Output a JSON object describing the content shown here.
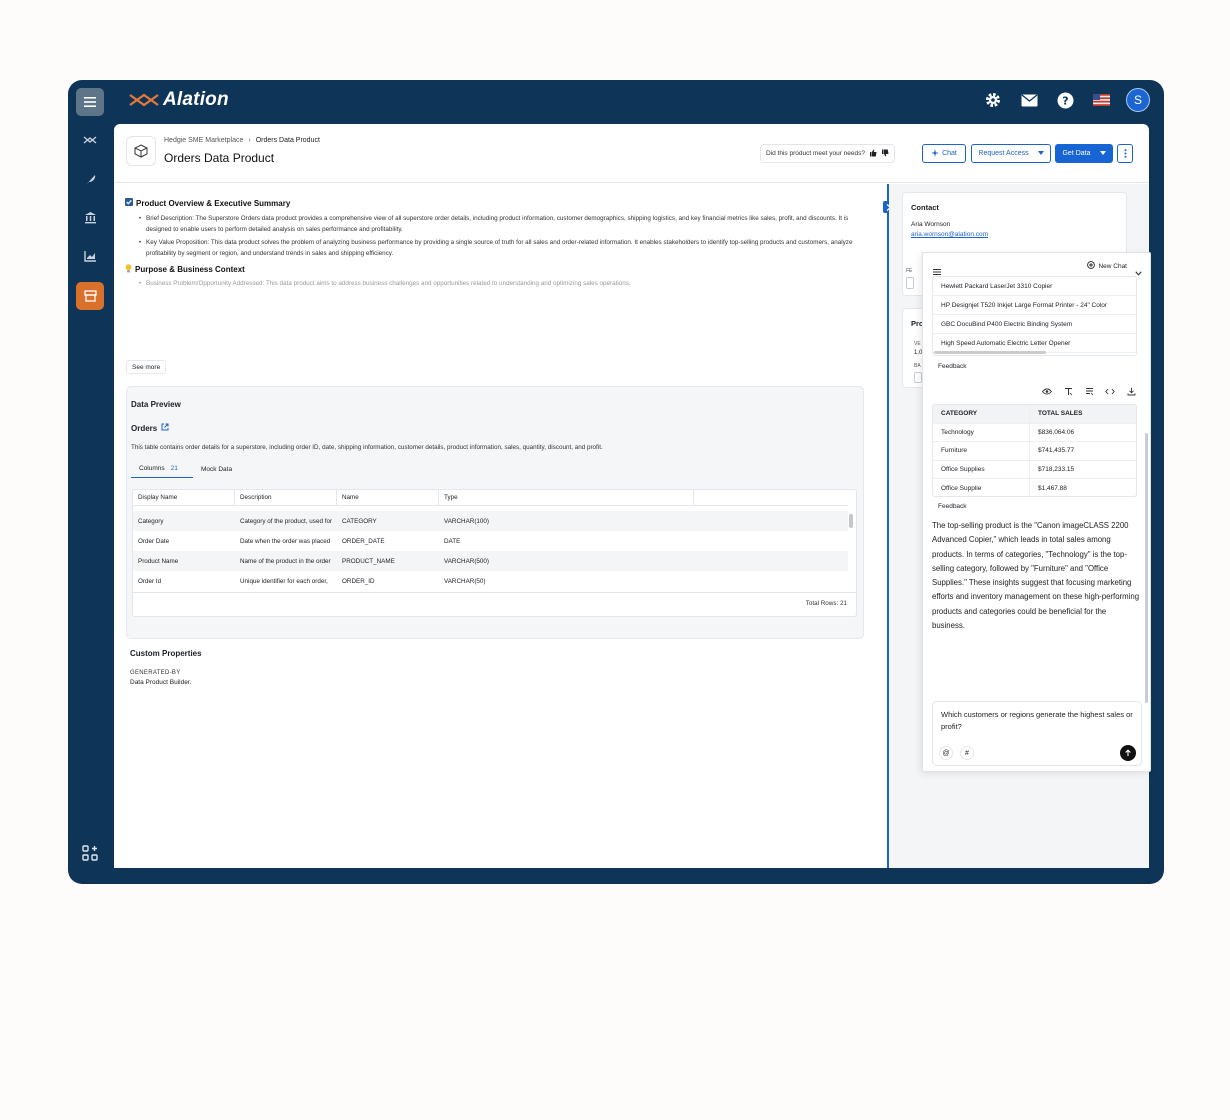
{
  "app": {
    "logo_text": "Alation",
    "avatar_initial": "S"
  },
  "colors": {
    "brand_navy": "#0e3557",
    "accent_blue": "#1b63c9",
    "active_orange": "#d9702c"
  },
  "sidebar": {
    "items": [
      "menu-icon",
      "lineage-icon",
      "feather-icon",
      "bank-icon",
      "chart-icon",
      "marketplace-icon",
      "apps-add-icon"
    ]
  },
  "topbar": {
    "icons": [
      "gear-icon",
      "mail-icon",
      "help-icon",
      "flag-icon"
    ]
  },
  "breadcrumb": {
    "parent": "Hedgie SME Marketplace",
    "separator": "›",
    "current": "Orders Data Product"
  },
  "page": {
    "title": "Orders Data Product"
  },
  "actions": {
    "feedback_question": "Did this product meet your needs?",
    "chat": "Chat",
    "request_access": "Request Access",
    "get_data": "Get Data"
  },
  "overview": {
    "title": "Product Overview & Executive Summary",
    "bullet1": "Brief Description: The Superstore Orders data product provides a comprehensive view of all superstore order details, including product information, customer demographics, shipping logistics, and key financial metrics like sales, profit, and discounts. It is designed to enable users to perform detailed analysis on sales performance and profitability.",
    "bullet2": "Key Value Proposition: This data product solves the problem of analyzing business performance by providing a single source of truth for all sales and order-related information. It enables stakeholders to identify top-selling products and customers, analyze profitability by segment or region, and understand trends in sales and shipping efficiency.",
    "purpose_title": "Purpose & Business Context",
    "bullet3": "Business Problem/Opportunity Addressed: This data product aims to address business challenges and opportunities related to understanding and optimizing sales operations.",
    "see_more": "See more"
  },
  "data_preview": {
    "title": "Data Preview",
    "table_name": "Orders",
    "description": "This table contains order details for a superstore, including order ID, date, shipping information, customer details, product information, sales, quantity, discount, and profit.",
    "tabs": [
      {
        "label": "Columns",
        "count": "21"
      },
      {
        "label": "Mock Data"
      }
    ],
    "headers": [
      "Display Name",
      "Description",
      "Name",
      "Type"
    ],
    "rows": [
      [
        "Category",
        "Category of the product, used for",
        "CATEGORY",
        "VARCHAR(100)"
      ],
      [
        "Order Date",
        "Date when the order was placed",
        "ORDER_DATE",
        "DATE"
      ],
      [
        "Product Name",
        "Name of the product in the order",
        "PRODUCT_NAME",
        "VARCHAR(500)"
      ],
      [
        "Order Id",
        "Unique identifier for each order,",
        "ORDER_ID",
        "VARCHAR(50)"
      ]
    ],
    "total_rows": "Total Rows: 21"
  },
  "custom_properties": {
    "title": "Custom Properties",
    "key": "GENERATED-BY",
    "value": "Data Product Builder."
  },
  "contact": {
    "title": "Contact",
    "name": "Aria Wornson",
    "email": "aria.wornson@alation.com"
  },
  "right_card2": {
    "title_fragment": "Pro",
    "label1": "VE",
    "label2": "1.0",
    "label3": "BA",
    "label4": "FE"
  },
  "chat": {
    "new_chat": "New Chat",
    "products": [
      "Hewlett Packard LaserJet 3310 Copier",
      "HP Designjet T520 Inkjet Large Format Printer - 24\" Color",
      "GBC DocuBind P400 Electric Binding System",
      "High Speed Automatic Electric Letter Opener"
    ],
    "feedback": "Feedback",
    "result_headers": [
      "CATEGORY",
      "TOTAL SALES"
    ],
    "result_rows": [
      [
        "Technology",
        "$836,064.06"
      ],
      [
        "Furniture",
        "$741,435.77"
      ],
      [
        "Office Supplies",
        "$718,233.15"
      ],
      [
        "Office Supplie",
        "$1,467.88"
      ]
    ],
    "answer": "The top-selling product is the \"Canon imageCLASS 2200 Advanced Copier,\" which leads in total sales among products. In terms of categories, \"Technology\" is the top-selling category, followed by \"Furniture\" and \"Office Supplies.\" These insights suggest that focusing marketing efforts and inventory management on these high-performing products and categories could be beneficial for the business.",
    "input_value": "Which customers or regions generate the highest sales or profit?",
    "at_symbol": "@",
    "hash_symbol": "#"
  }
}
